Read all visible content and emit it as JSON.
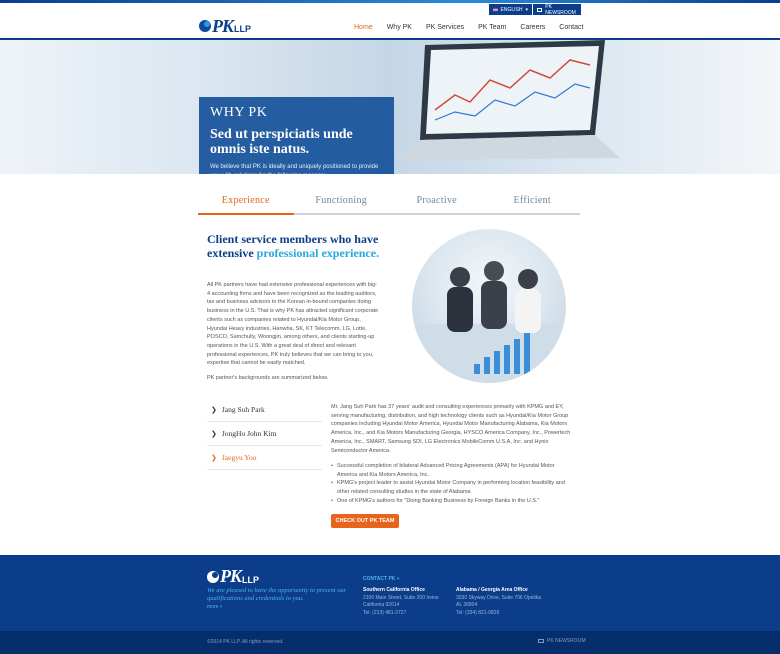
{
  "header": {
    "logo_text": "PK",
    "logo_sub": "LLP",
    "language": "ENGLISH",
    "newsroom": "PK NEWSROOM",
    "nav": [
      "Home",
      "Why PK",
      "PK Services",
      "PK Team",
      "Careers",
      "Contact"
    ],
    "active_nav": "Home"
  },
  "hero": {
    "title": "WHY PK",
    "subtitle": "Sed ut perspiciatis unde omnis iste natus.",
    "text": "We believe that PK is ideally and uniquely positioned to provide you with solutions for the following reasons:"
  },
  "tabs": [
    "Experience",
    "Functioning",
    "Proactive",
    "Efficient"
  ],
  "active_tab": "Experience",
  "section": {
    "title_part1": "Client service members who have extensive ",
    "title_highlight": "professional experience.",
    "body": "All PK partners have had extensive professional experiences with big-4 accounting firms and have been recognized as the leading auditors, tax and business advisors to the Korean in-bound companies doing business in the U.S. That is why PK has attracted significant corporate clients such as companies related to Hyundai/Kia Motor Group, Hyundai Heavy industries, Hanwha, SK, KT Telecomm, LG, Lotte, POSCO, Samchully, Woongjin, among others, and clients starting-up operations in the U.S. With a great deal of direct and relevant professional experiences, PK truly believes that we can bring to you, expertise that cannot be easily matched.",
    "note": "PK partner's backgrounds are summarized below."
  },
  "people": [
    {
      "name": "Jang Suh Park",
      "active": false
    },
    {
      "name": "JongHo John Kim",
      "active": false
    },
    {
      "name": "Jaegyu Yoo",
      "active": true
    }
  ],
  "bio": {
    "text": "Mr. Jang Suh Park has 37 years' audit and consulting experiences primarily with KPMG and EY, serving manufacturing, distribution, and high technology clients such as Hyundai/Kia Motor Group companies including Hyundai Motor America, Hyundai Motor Manufacturing Alabama, Kia Motors America, Inc., and Kia Motors Manufacturing Georgia, HYSCO America Company, Inc., Powertech America, Inc., SMART, Samsung SDI, LG Electronics MobileComm U.S.A, Inc. and Hynix Semiconductor America.",
    "bullets": [
      "Successful completion of bilateral Advanced Pricing Agreements (APA) for Hyundai Motor America and Kia Motors America, Inc.",
      "KPMG's project leader to assist Hyundai Motor Company in performing location feasibility and other related consulting studies in the state of Alabama",
      "One of KPMG's authors for \"Doing Banking Business by Foreign Banks in the U.S.\""
    ],
    "cta": "CHECK OUT PK TEAM"
  },
  "footer": {
    "tagline": "We are pleased to have the opportunity to present our qualifications and credentials to you.",
    "more": "more »",
    "contact_link": "CONTACT PK »",
    "offices": [
      {
        "name": "Southern California Office",
        "line1": "2100 Main Street, Suite 200 Irvine",
        "line2": "California 92614",
        "phone": "Tel: (213) 481-2727"
      },
      {
        "name": "Alabama / Georgia Area Office",
        "line1": "3030 Skyway Drive, Suite 706 Opelika",
        "line2": "AL 36804",
        "phone": "Tel: (334) 821-0826"
      }
    ],
    "copyright": "©2014 PK LLP. All rights reserved.",
    "newsroom": "PK NEWSROOM"
  },
  "colors": {
    "brand": "#0b3d8a",
    "accent": "#e8641c",
    "highlight": "#27a8e0"
  }
}
